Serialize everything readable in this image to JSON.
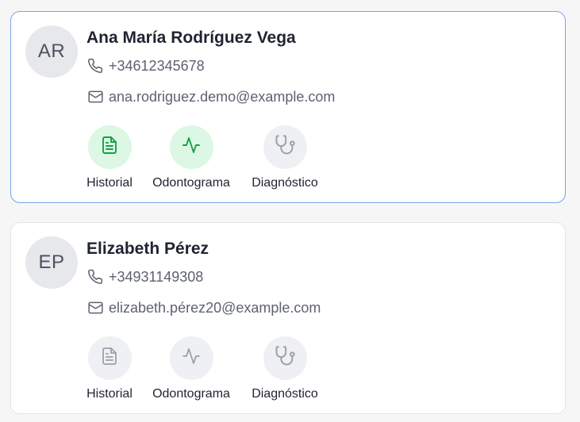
{
  "colors": {
    "active_icon": "#1a9e48",
    "inactive_icon": "#9aa0ab",
    "selected_border": "#7aa2e6"
  },
  "patients": [
    {
      "initials": "AR",
      "name": "Ana María Rodríguez Vega",
      "phone": "+34612345678",
      "email": "ana.rodriguez.demo@example.com",
      "selected": true,
      "actions": [
        {
          "label": "Historial",
          "icon": "document-icon",
          "active": true
        },
        {
          "label": "Odontograma",
          "icon": "activity-pulse-icon",
          "active": true
        },
        {
          "label": "Diagnóstico",
          "icon": "stethoscope-icon",
          "active": false
        }
      ]
    },
    {
      "initials": "EP",
      "name": "Elizabeth Pérez",
      "phone": "+34931149308",
      "email": "elizabeth.pérez20@example.com",
      "selected": false,
      "actions": [
        {
          "label": "Historial",
          "icon": "document-icon",
          "active": false
        },
        {
          "label": "Odontograma",
          "icon": "activity-pulse-icon",
          "active": false
        },
        {
          "label": "Diagnóstico",
          "icon": "stethoscope-icon",
          "active": false
        }
      ]
    }
  ]
}
